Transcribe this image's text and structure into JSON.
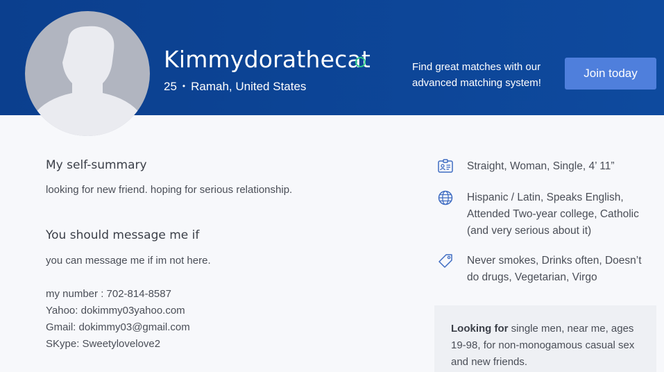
{
  "profile": {
    "username": "Kimmydorathecat",
    "age": "25",
    "separator": "•",
    "location": "Ramah, United States"
  },
  "promo": {
    "text": "Find great matches with our advanced matching system!",
    "join_label": "Join today"
  },
  "summary": {
    "title": "My self-summary",
    "text": "looking for new friend. hoping for serious relationship."
  },
  "message_me": {
    "title": "You should message me if",
    "text": "you can message me if im not here.\n\nmy number : 702-814-8587\nYahoo: dokimmy03yahoo.com\nGmail: dokimmy03@gmail.com\nSKype: Sweetylovelove2"
  },
  "details": [
    {
      "icon": "id-card-icon",
      "text": "Straight, Woman, Single, 4’ 11”"
    },
    {
      "icon": "globe-icon",
      "text": "Hispanic / Latin, Speaks English, Attended Two-year college, Catholic (and very serious about it)"
    },
    {
      "icon": "tag-icon",
      "text": "Never smokes, Drinks often, Doesn’t do drugs, Vegetarian, Virgo"
    }
  ],
  "looking_for": {
    "label": "Looking for",
    "text": " single men, near me, ages 19-98, for non-monogamous casual sex and new friends."
  },
  "colors": {
    "header": "#0e4a9e",
    "button": "#4f7fdc",
    "online": "#2fc98a",
    "icon": "#3f6cc2"
  }
}
